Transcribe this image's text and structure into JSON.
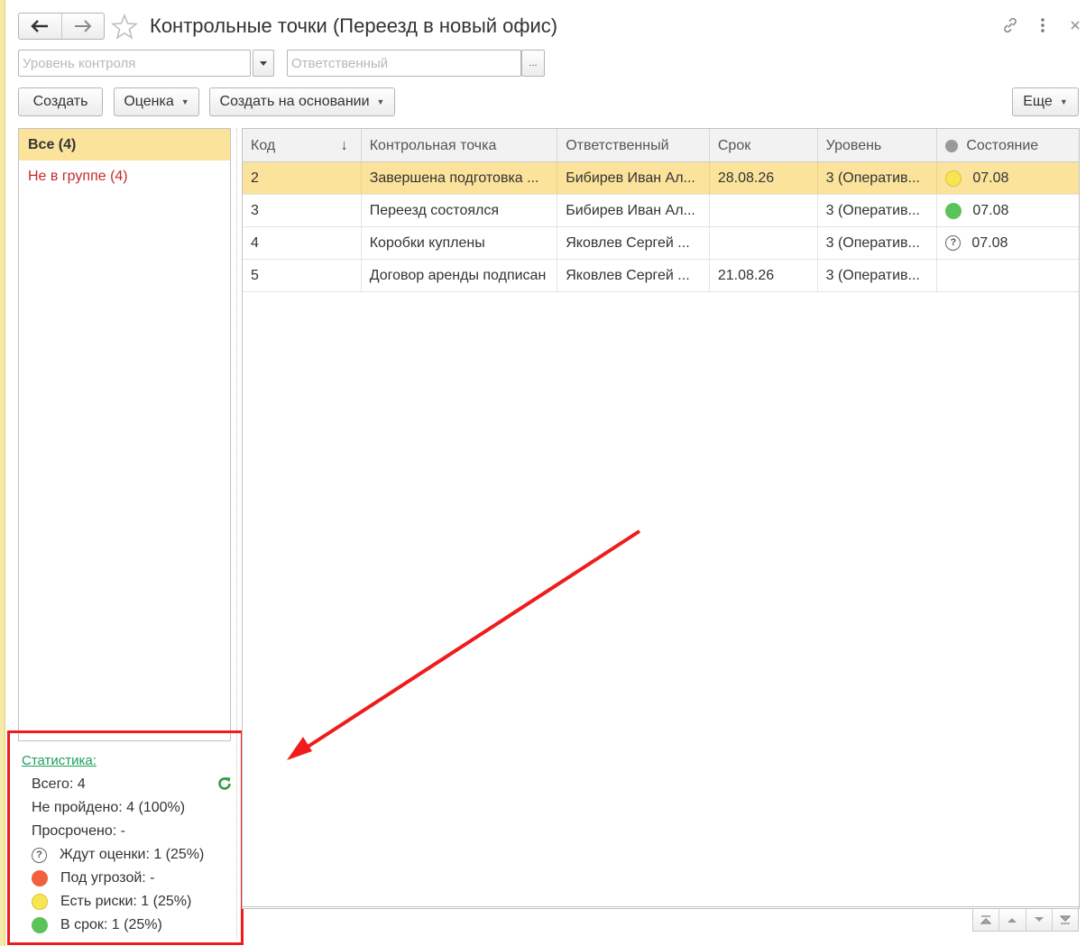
{
  "window": {
    "title": "Контрольные точки (Переезд в новый офис)",
    "icons": [
      "back-arrow-icon",
      "forward-arrow-icon",
      "favorite-star-icon",
      "link-icon",
      "more-vertical-icon",
      "close-icon"
    ]
  },
  "filters": {
    "level_placeholder": "Уровень контроля",
    "responsible_placeholder": "Ответственный",
    "select_button": "..."
  },
  "toolbar": {
    "create": "Создать",
    "rate": "Оценка",
    "create_based_on": "Создать на основании",
    "more": "Еще"
  },
  "groups": [
    {
      "label": "Все (4)",
      "selected": true
    },
    {
      "label": "Не в группе (4)",
      "selected": false
    }
  ],
  "statistics": {
    "link": "Статистика:",
    "total": "Всего: 4",
    "not_passed": "Не пройдено: 4 (100%)",
    "overdue": "Просрочено: -",
    "awaiting": "Ждут оценки: 1 (25%)",
    "threatened": "Под угрозой: -",
    "risks": "Есть риски: 1 (25%)",
    "on_time": "В срок: 1 (25%)"
  },
  "table": {
    "columns": [
      "Код",
      "Контрольная точка",
      "Ответственный",
      "Срок",
      "Уровень",
      "Состояние"
    ],
    "sort_indicator": "↓",
    "rows": [
      {
        "code": "2",
        "point": "Завершена подготовка ...",
        "responsible": "Бибирев Иван Ал...",
        "deadline": "28.08.26",
        "level": "3 (Оператив...",
        "state": "07.08",
        "state_icon": "yellow",
        "selected": true
      },
      {
        "code": "3",
        "point": "Переезд состоялся",
        "responsible": "Бибирев Иван Ал...",
        "deadline": "",
        "level": "3 (Оператив...",
        "state": "07.08",
        "state_icon": "green",
        "selected": false
      },
      {
        "code": "4",
        "point": "Коробки куплены",
        "responsible": "Яковлев Сергей ...",
        "deadline": "",
        "level": "3 (Оператив...",
        "state": "07.08",
        "state_icon": "question",
        "selected": false
      },
      {
        "code": "5",
        "point": "Договор аренды подписан",
        "responsible": "Яковлев Сергей ...",
        "deadline": "21.08.26",
        "level": "3 (Оператив...",
        "state": "",
        "state_icon": "",
        "selected": false
      }
    ]
  },
  "colors": {
    "selection": "#fbe39c",
    "red_dot": "#f0613c",
    "yellow_dot": "#f7e552",
    "green_dot": "#5cc35a",
    "highlight": "#ee1c1c",
    "link": "#1aa05c"
  }
}
